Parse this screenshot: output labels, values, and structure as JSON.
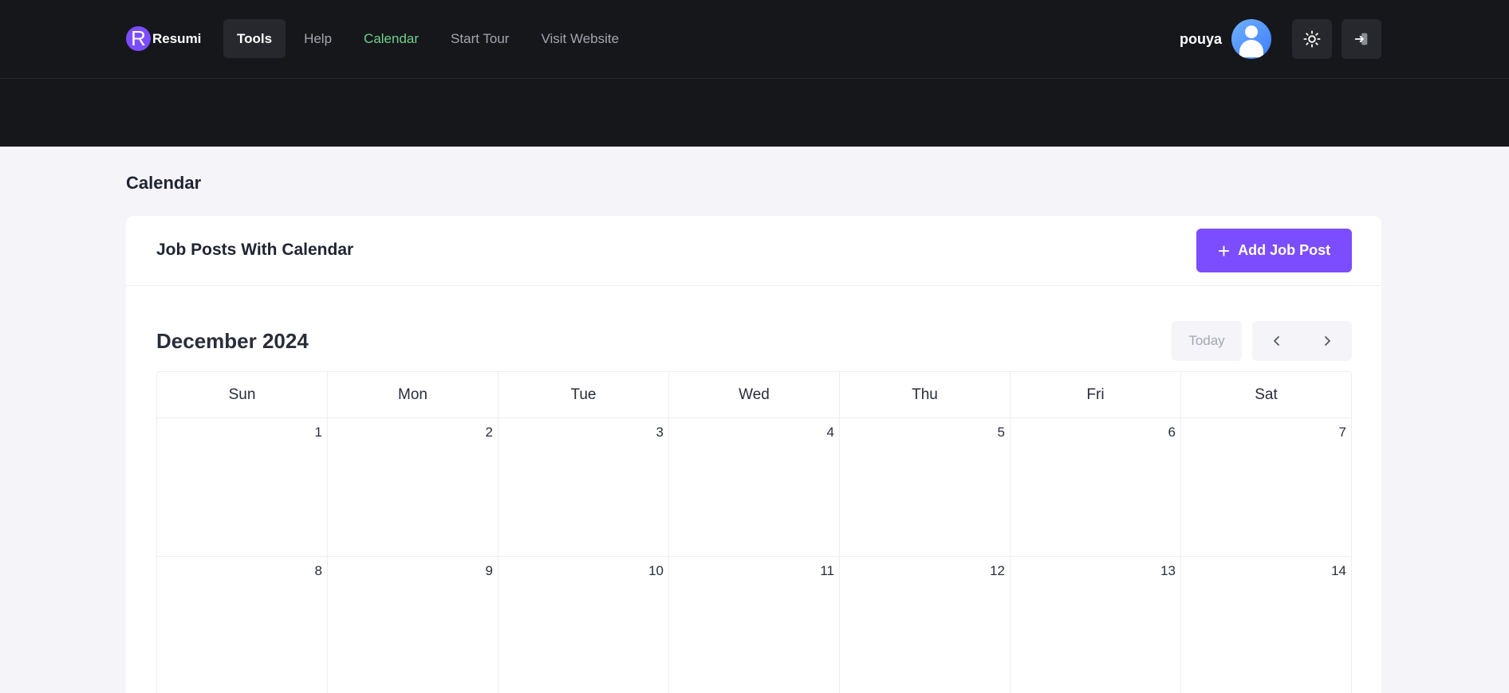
{
  "app": {
    "logo_letter": "R",
    "name": "Resumi"
  },
  "nav": [
    {
      "label": "Tools",
      "state": "active"
    },
    {
      "label": "Help",
      "state": ""
    },
    {
      "label": "Calendar",
      "state": "current"
    },
    {
      "label": "Start Tour",
      "state": ""
    },
    {
      "label": "Visit Website",
      "state": ""
    }
  ],
  "user": {
    "name": "pouya"
  },
  "icons": {
    "theme": "sun-icon",
    "logout": "sign-in-icon",
    "avatar": "user-avatar-icon",
    "add": "plus-icon",
    "prev": "chevron-left-icon",
    "next": "chevron-right-icon"
  },
  "colors": {
    "accent": "#7c4dff",
    "nav_current": "#6fd08c",
    "header_bg": "#16171b"
  },
  "page": {
    "title": "Calendar"
  },
  "card": {
    "title": "Job Posts With Calendar",
    "add_button": "Add Job Post"
  },
  "calendar": {
    "month_label": "December 2024",
    "today_label": "Today",
    "weekdays": [
      "Sun",
      "Mon",
      "Tue",
      "Wed",
      "Thu",
      "Fri",
      "Sat"
    ],
    "weeks": [
      [
        "1",
        "2",
        "3",
        "4",
        "5",
        "6",
        "7"
      ],
      [
        "8",
        "9",
        "10",
        "11",
        "12",
        "13",
        "14"
      ]
    ]
  }
}
